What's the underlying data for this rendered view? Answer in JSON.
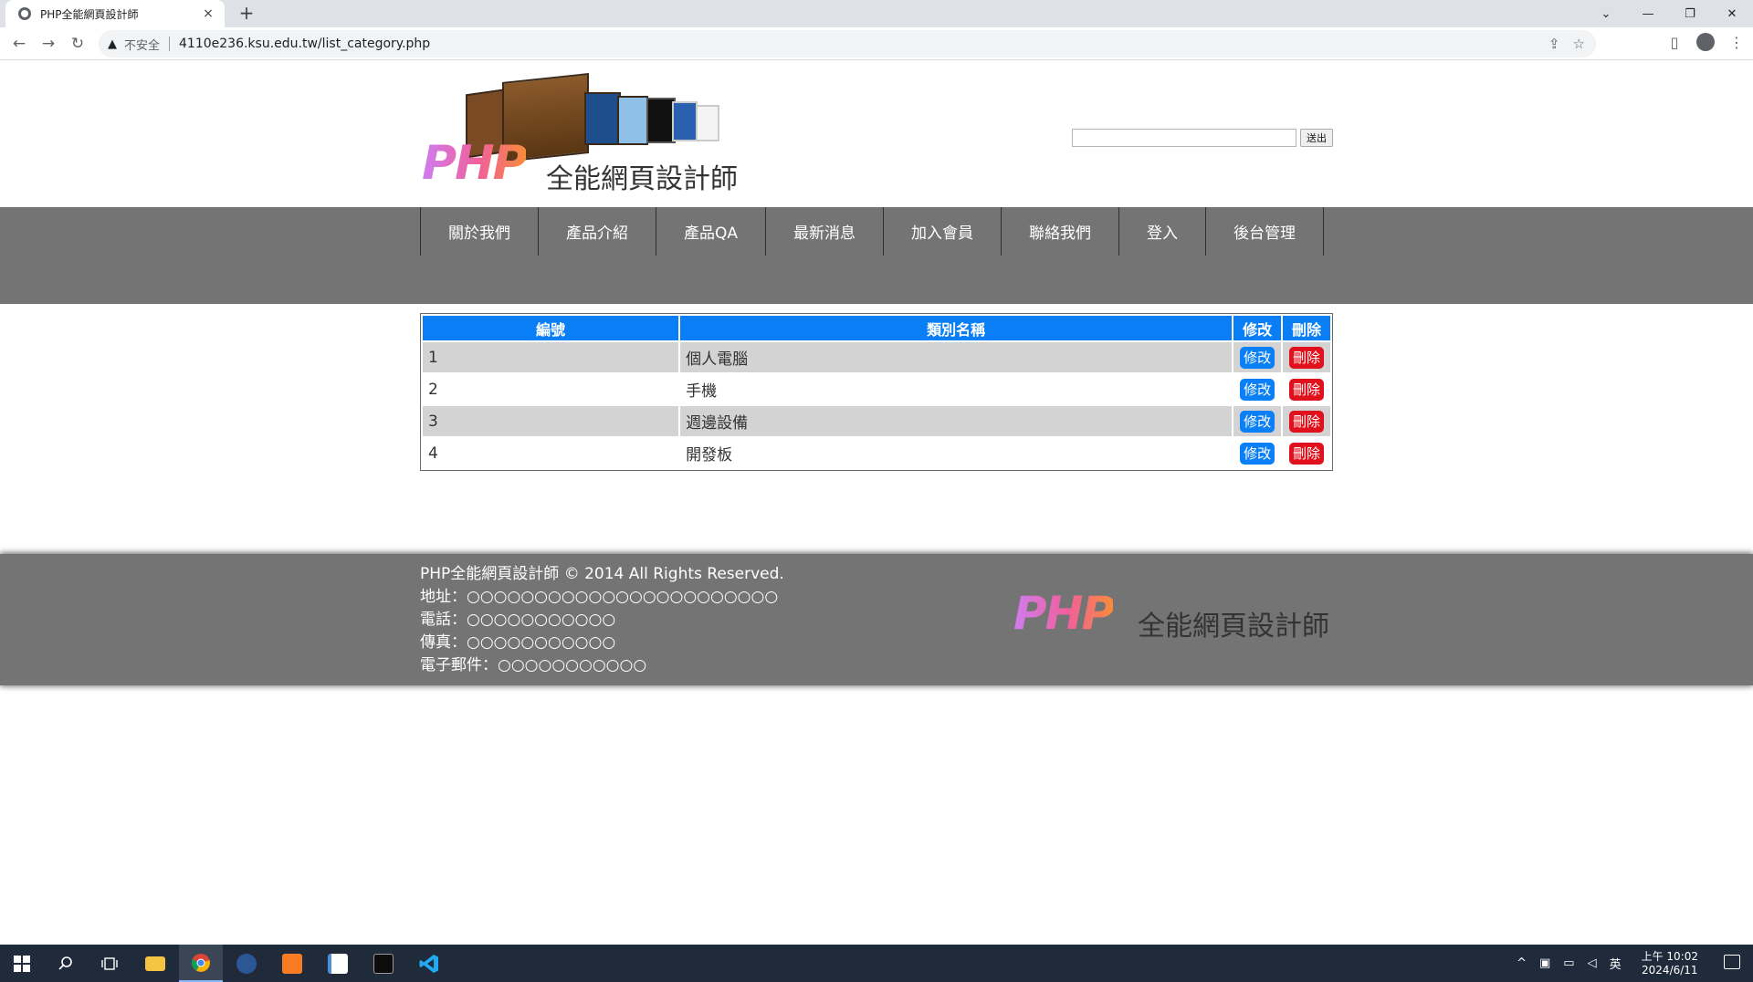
{
  "browser": {
    "tab_title": "PHP全能網頁設計師",
    "tab_close": "×",
    "new_tab": "+",
    "security_label": "不安全",
    "url": "4110e236.ksu.edu.tw/list_category.php",
    "window_min": "—",
    "window_restore": "❐",
    "window_close": "✕",
    "tab_search": "⌄",
    "back": "←",
    "forward": "→",
    "reload": "↻",
    "share": "⇪",
    "star": "☆",
    "sidepanel": "▯",
    "menu": "⋮"
  },
  "header": {
    "logo_php": "PHP",
    "logo_text": "全能網頁設計師",
    "search_value": "",
    "search_button": "送出"
  },
  "nav": {
    "items": [
      {
        "label": "關於我們"
      },
      {
        "label": "產品介紹"
      },
      {
        "label": "產品QA"
      },
      {
        "label": "最新消息"
      },
      {
        "label": "加入會員"
      },
      {
        "label": "聯絡我們"
      },
      {
        "label": "登入"
      },
      {
        "label": "後台管理"
      }
    ]
  },
  "table": {
    "headers": [
      "編號",
      "類別名稱",
      "修改",
      "刪除"
    ],
    "rows": [
      {
        "id": "1",
        "name": "個人電腦",
        "edit": "修改",
        "delete": "刪除"
      },
      {
        "id": "2",
        "name": "手機",
        "edit": "修改",
        "delete": "刪除"
      },
      {
        "id": "3",
        "name": "週邊設備",
        "edit": "修改",
        "delete": "刪除"
      },
      {
        "id": "4",
        "name": "開發板",
        "edit": "修改",
        "delete": "刪除"
      }
    ]
  },
  "footer": {
    "copyright": "PHP全能網頁設計師 © 2014 All Rights Reserved.",
    "address": "地址：○○○○○○○○○○○○○○○○○○○○○○○",
    "phone": "電話：○○○○○○○○○○○",
    "fax": "傳真：○○○○○○○○○○○",
    "email": "電子郵件：○○○○○○○○○○○",
    "logo_php": "PHP",
    "logo_text": "全能網頁設計師"
  },
  "taskbar": {
    "ime": "英",
    "time": "上午 10:02",
    "date": "2024/6/11"
  },
  "colors": {
    "nav_bg": "#747474",
    "header_blue": "#0a7ff5",
    "edit_blue": "#0b7ff5",
    "delete_red": "#e0101c",
    "row_gray": "#d3d3d3"
  }
}
